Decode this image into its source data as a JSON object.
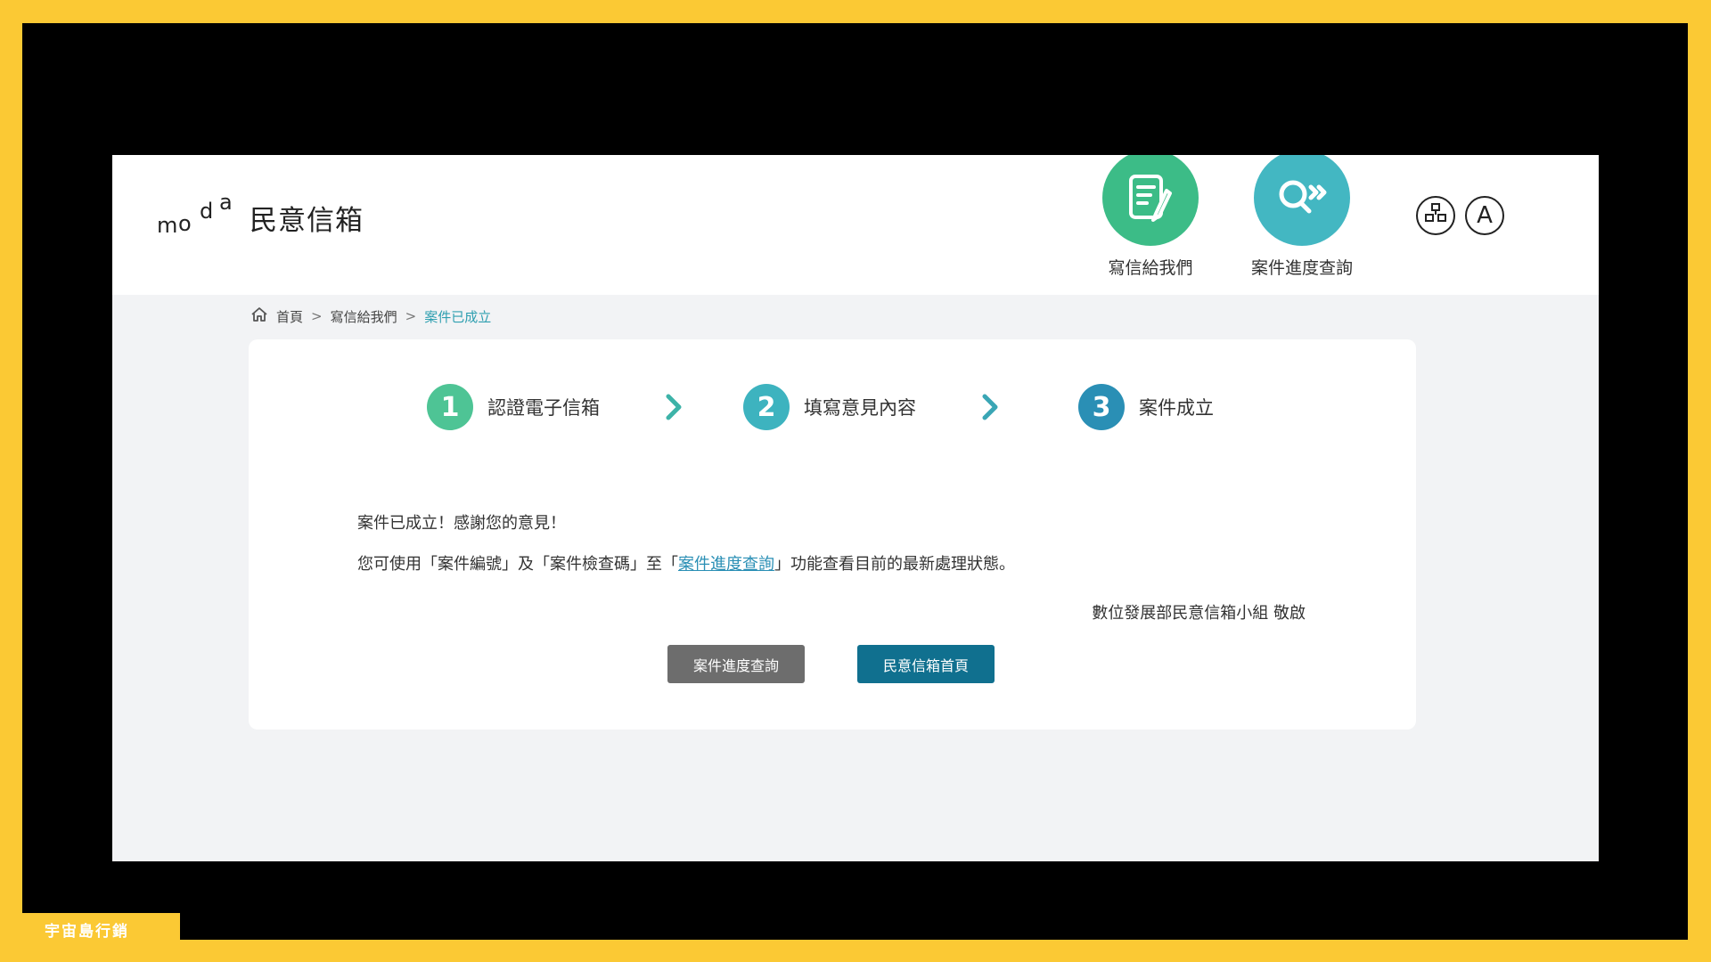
{
  "header": {
    "logo_letters": [
      "m",
      "o",
      "d",
      "a"
    ],
    "site_title": "民意信箱",
    "nav": [
      {
        "label": "寫信給我們",
        "icon": "edit-document-icon"
      },
      {
        "label": "案件進度查詢",
        "icon": "search-forward-icon"
      }
    ],
    "utilities": {
      "sitemap_icon": "sitemap-icon",
      "font_size_label": "A"
    }
  },
  "breadcrumb": {
    "home_icon": "home-icon",
    "items": [
      "首頁",
      "寫信給我們",
      "案件已成立"
    ],
    "separator": ">"
  },
  "steps": [
    {
      "number": "1",
      "label": "認證電子信箱",
      "color": "#4ec495"
    },
    {
      "number": "2",
      "label": "填寫意見內容",
      "color": "#3db3bf"
    },
    {
      "number": "3",
      "label": "案件成立",
      "color": "#2a8fb5"
    }
  ],
  "message": {
    "line1": "案件已成立！感謝您的意見！",
    "line2_before": "您可使用「案件編號」及「案件檢查碼」至「",
    "line2_link": "案件進度查詢",
    "line2_after": "」功能查看目前的最新處理狀態。",
    "signature": "數位發展部民意信箱小組 敬啟"
  },
  "buttons": {
    "progress": "案件進度查詢",
    "home": "民意信箱首頁"
  },
  "watermark": "宇宙島行銷",
  "colors": {
    "frame": "#fbc934",
    "nav_write": "#3cbc87",
    "nav_progress": "#43b7c2",
    "primary_button": "#10708f",
    "secondary_button": "#6d6d6d"
  }
}
